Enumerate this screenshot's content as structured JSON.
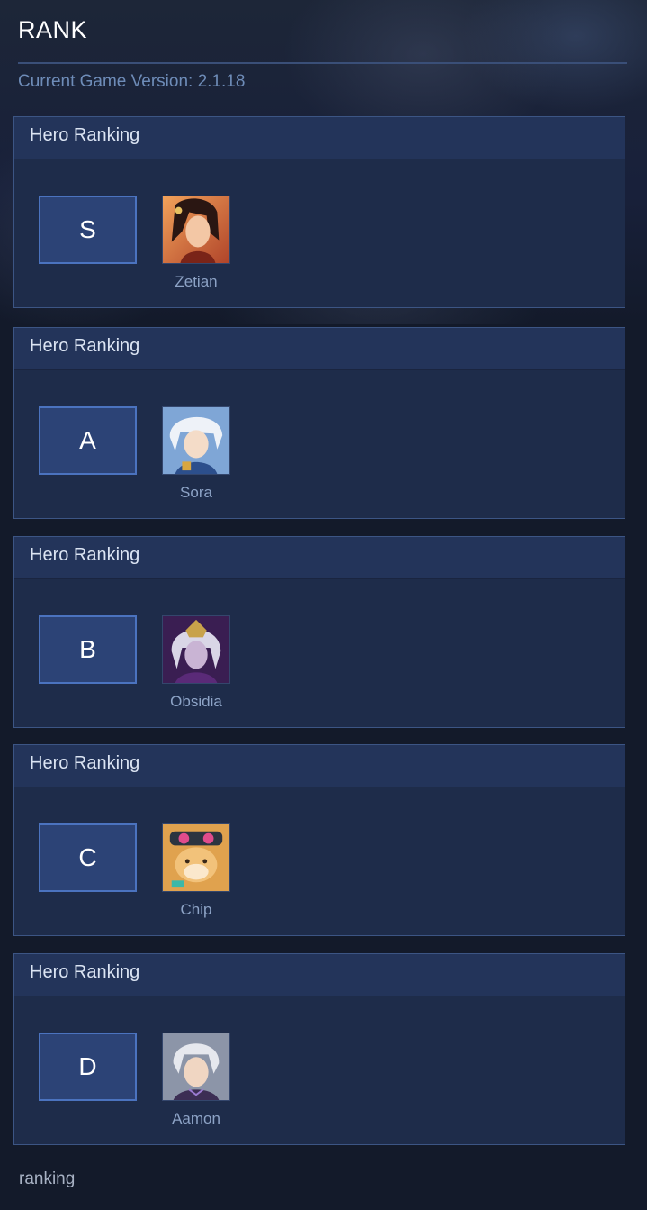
{
  "header": {
    "title": "RANK",
    "version": "Current Game Version: 2.1.18"
  },
  "ranks": [
    {
      "heading": "Hero Ranking",
      "tier": "S",
      "hero": {
        "name": "Zetian"
      }
    },
    {
      "heading": "Hero Ranking",
      "tier": "A",
      "hero": {
        "name": "Sora"
      }
    },
    {
      "heading": "Hero Ranking",
      "tier": "B",
      "hero": {
        "name": "Obsidia"
      }
    },
    {
      "heading": "Hero Ranking",
      "tier": "C",
      "hero": {
        "name": "Chip"
      }
    },
    {
      "heading": "Hero Ranking",
      "tier": "D",
      "hero": {
        "name": "Aamon"
      }
    }
  ],
  "footer": {
    "text": "ranking"
  },
  "colors": {
    "background": "#131a2a",
    "card": "#1e2c4a",
    "card_header": "#23345a",
    "tier_box": "#2c4376",
    "tier_border": "#4b73bf",
    "accent_text": "#6e8cb8"
  }
}
